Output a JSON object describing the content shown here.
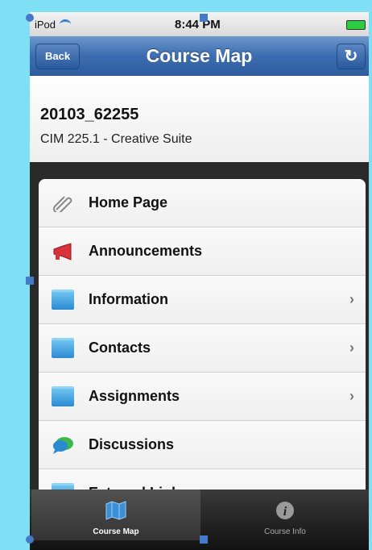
{
  "status_bar": {
    "carrier": "iPod",
    "time": "8:44 PM"
  },
  "nav_bar": {
    "back_label": "Back",
    "title": "Course Map",
    "refresh_icon": "refresh-icon"
  },
  "course": {
    "code": "20103_62255",
    "name": "CIM 225.1 - Creative Suite"
  },
  "menu": {
    "items": [
      {
        "label": "Home Page",
        "icon": "paperclip-icon",
        "chevron": ""
      },
      {
        "label": "Announcements",
        "icon": "megaphone-icon",
        "chevron": ""
      },
      {
        "label": "Information",
        "icon": "folder-icon",
        "chevron": "›"
      },
      {
        "label": "Contacts",
        "icon": "folder-icon",
        "chevron": "›"
      },
      {
        "label": "Assignments",
        "icon": "folder-icon",
        "chevron": "›"
      },
      {
        "label": "Discussions",
        "icon": "chat-icon",
        "chevron": ""
      },
      {
        "label": "External Links",
        "icon": "folder-icon",
        "chevron": "›"
      }
    ]
  },
  "tab_bar": {
    "tabs": [
      {
        "label": "Course Map",
        "icon": "map-icon",
        "active": true
      },
      {
        "label": "Course Info",
        "icon": "info-icon",
        "active": false
      }
    ]
  },
  "colors": {
    "nav_bar": "#3d6db0",
    "background": "#7fe0f5",
    "tab_bar": "#111111"
  }
}
